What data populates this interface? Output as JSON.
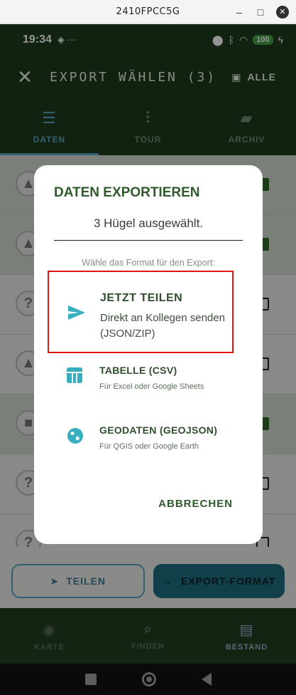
{
  "window": {
    "title": "2410FPCC5G",
    "controls": [
      "–",
      "□",
      "✕"
    ]
  },
  "statusbar": {
    "time": "19:34",
    "battery": "100"
  },
  "appbar": {
    "title": "EXPORT WÄHLEN (3)",
    "select_all": "ALLE"
  },
  "tabs": [
    {
      "label": "DATEN",
      "icon": "list-icon",
      "active": true
    },
    {
      "label": "TOUR",
      "icon": "tour-icon",
      "active": false
    },
    {
      "label": "ARCHIV",
      "icon": "archive-icon",
      "active": false
    }
  ],
  "actions": {
    "share": "TEILEN",
    "export": "EXPORT-FORMAT"
  },
  "bottom_nav": [
    {
      "label": "KARTE",
      "icon": "compass-icon",
      "active": false
    },
    {
      "label": "FINDEN",
      "icon": "search-icon",
      "active": false
    },
    {
      "label": "BESTAND",
      "icon": "inventory-icon",
      "active": true
    }
  ],
  "dialog": {
    "title": "DATEN EXPORTIEREN",
    "count": "3 Hügel ausgewählt.",
    "hint": "Wähle das Format für den Export:",
    "options": [
      {
        "name": "JETZT TEILEN",
        "desc": "Direkt an Kollegen senden (JSON/ZIP)",
        "icon": "send-icon"
      },
      {
        "name": "TABELLE (CSV)",
        "desc": "Für Excel oder Google Sheets",
        "icon": "table-icon"
      },
      {
        "name": "GEODATEN (GEOJSON)",
        "desc": "Für QGIS oder Google Earth",
        "icon": "globe-icon"
      }
    ],
    "cancel": "ABBRECHEN"
  },
  "colors": {
    "primary_dark": "#1f3b1c",
    "accent": "#36aebf",
    "highlight_border": "#e01717"
  }
}
